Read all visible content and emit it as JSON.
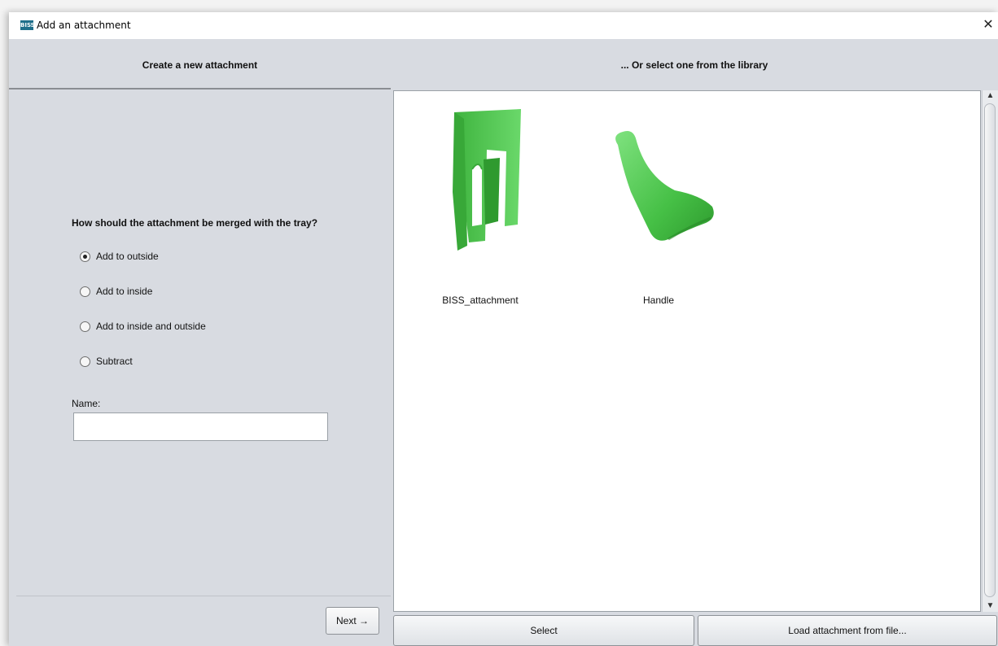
{
  "window": {
    "title": "Add an attachment",
    "app_icon_text": "BISS",
    "close_glyph": "✕"
  },
  "left": {
    "header": "Create a new attachment",
    "question": "How should the attachment be merged with the tray?",
    "options": [
      {
        "label": "Add to outside",
        "checked": true
      },
      {
        "label": "Add to inside",
        "checked": false
      },
      {
        "label": "Add to inside and outside",
        "checked": false
      },
      {
        "label": "Subtract",
        "checked": false
      }
    ],
    "name_label": "Name:",
    "name_value": "",
    "next_label": "Next →"
  },
  "right": {
    "header": "... Or select one from the library",
    "items": [
      {
        "label": "BISS_attachment",
        "icon": "biss-attachment-thumbnail"
      },
      {
        "label": "Handle",
        "icon": "handle-thumbnail"
      }
    ],
    "select_label": "Select",
    "load_label": "Load attachment from file..."
  },
  "colors": {
    "panel": "#d8dbe1",
    "model_green": "#4fc94f"
  }
}
